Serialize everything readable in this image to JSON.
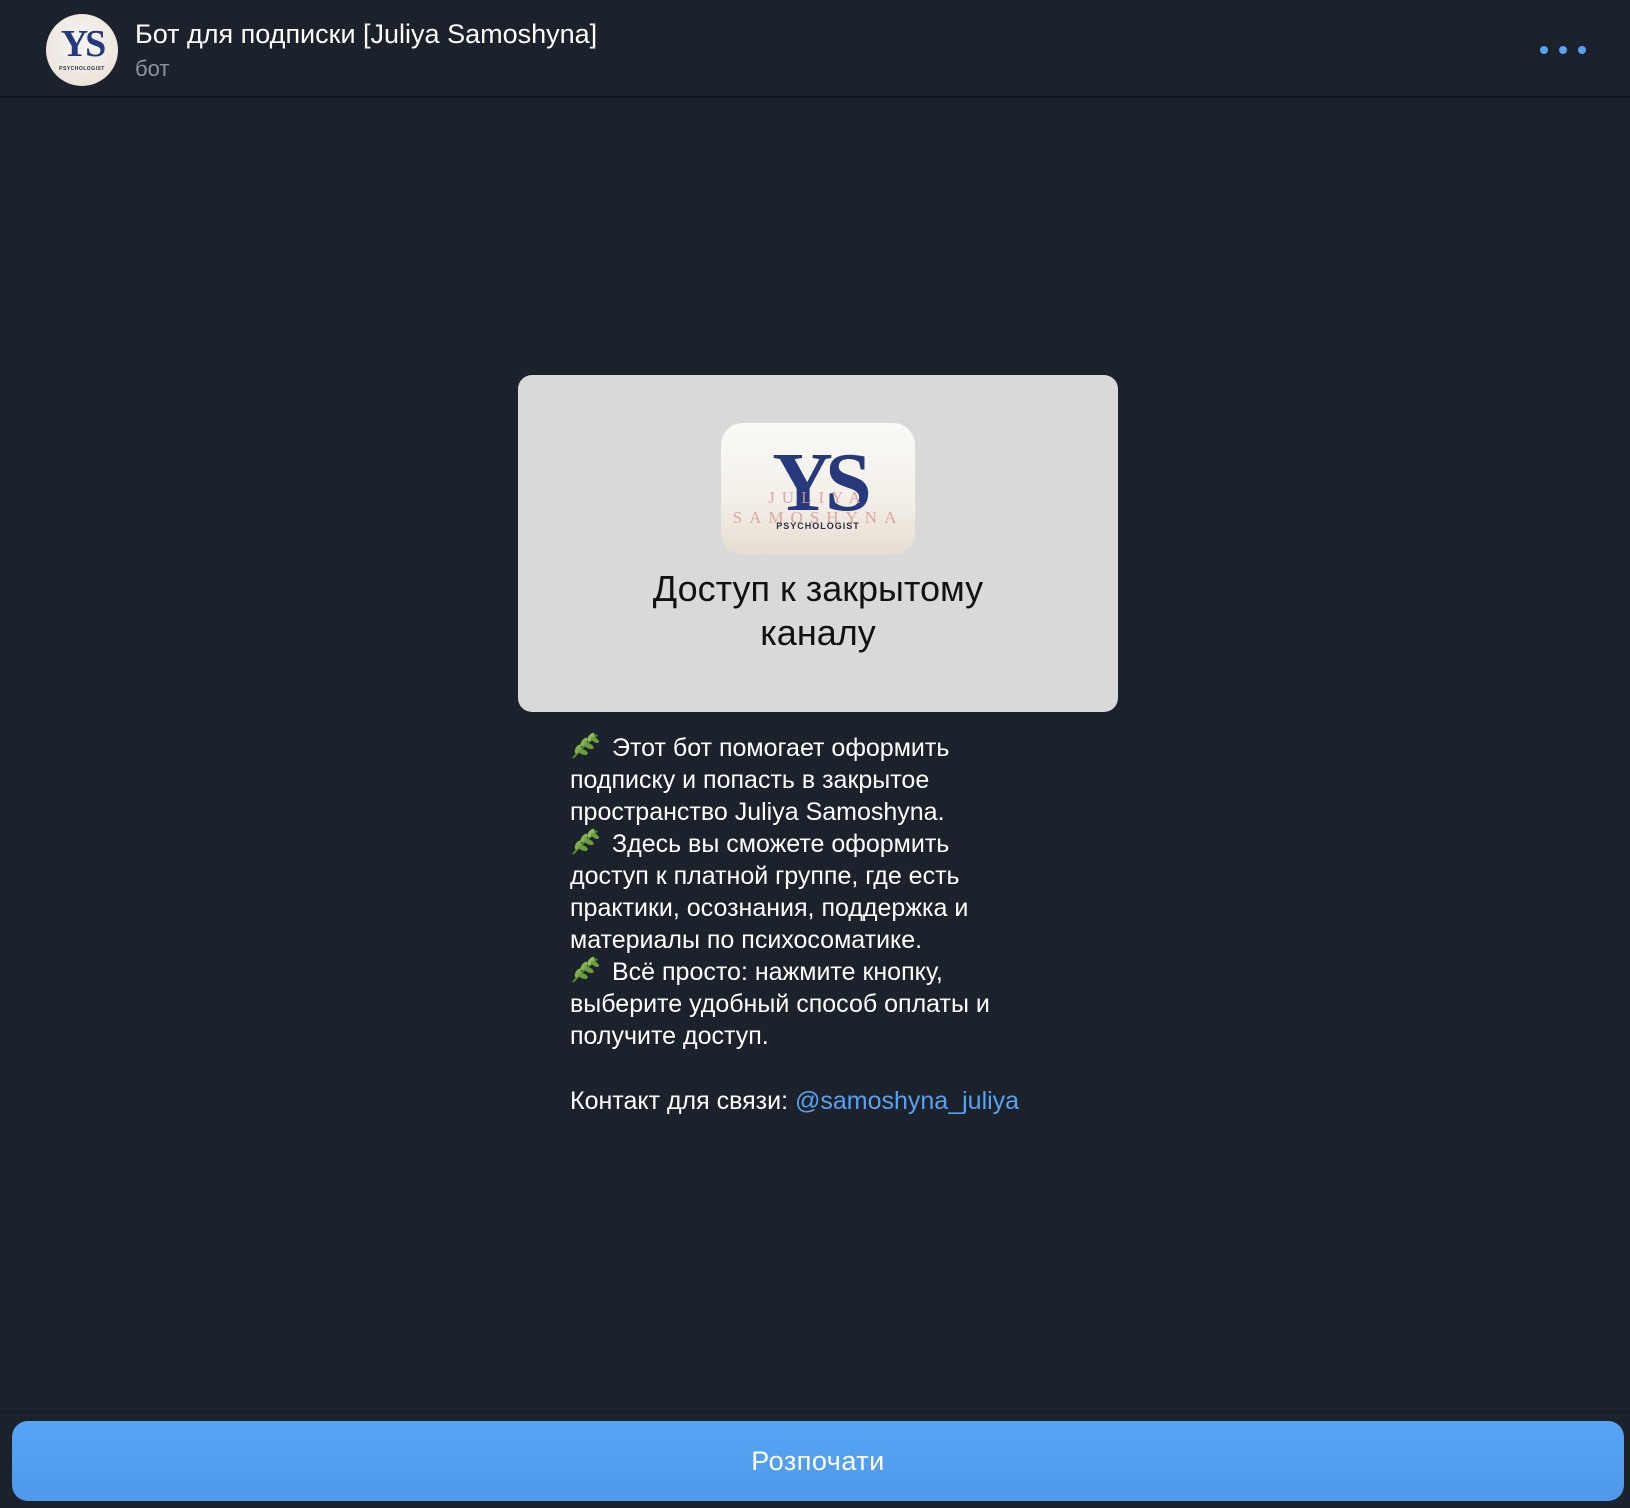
{
  "header": {
    "title": "Бот для подписки [Juliya Samoshyna]",
    "subtitle": "бот",
    "avatar_initials": "YS",
    "avatar_caption": "PSYCHOLOGIST",
    "more_icon": "more-horizontal-icon"
  },
  "card": {
    "logo_initials": "YS",
    "logo_name": "JULIYA SAMOSHYNA",
    "logo_caption": "PSYCHOLOGIST",
    "text_line1": "Доступ к закрытому",
    "text_line2": "каналу"
  },
  "description": {
    "leaf_icon": "leaf-icon",
    "p1_line1": "Этот бот помогает оформить",
    "p1_line2": "подписку и попасть в закрытое",
    "p1_line3": "пространство Juliya Samoshyna.",
    "p2_line1": "Здесь вы сможете оформить",
    "p2_line2": "доступ к платной группе, где есть",
    "p2_line3": "практики, осознания, поддержка и",
    "p2_line4": "материалы по психосоматике.",
    "p3_line1": "Всё просто: нажмите кнопку,",
    "p3_line2": "выберите удобный способ оплаты и",
    "p3_line3": "получите доступ."
  },
  "contact": {
    "label": "Контакт для связи: ",
    "handle": "@samoshyna_juliya"
  },
  "bottom": {
    "start_label": "Розпочати"
  },
  "colors": {
    "background": "#1b222c",
    "accent": "#5aa2f0",
    "button": "#53a0f2",
    "card": "#d9d9d9",
    "logo_blue": "#27397d"
  }
}
